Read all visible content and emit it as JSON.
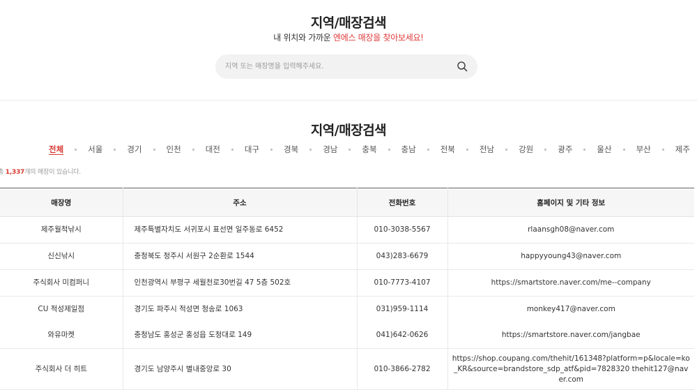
{
  "header": {
    "title": "지역/매장검색",
    "subtitle_prefix": "내 위치와 가까운 ",
    "subtitle_accent": "엔에스 매장을 찾아보세요!",
    "search_placeholder": "지역 또는 매장명을 입력해주세요."
  },
  "section": {
    "title": "지역/매장검색",
    "regions": [
      "전체",
      "서울",
      "경기",
      "인천",
      "대전",
      "대구",
      "경북",
      "경남",
      "충북",
      "충남",
      "전북",
      "전남",
      "강원",
      "광주",
      "울산",
      "부산",
      "제주"
    ],
    "active_region": "전체",
    "count_prefix": "총 ",
    "count_value": "1,337",
    "count_suffix": "개의 매장이 있습니다."
  },
  "table": {
    "headers": [
      "매장명",
      "주소",
      "전화번호",
      "홈페이지 및 기타 정보"
    ],
    "rows": [
      {
        "name": "제주월척낚시",
        "address": "제주특별자치도 서귀포시 표선면 일주동로 6452",
        "phone": "010-3038-5567",
        "info": "rlaansgh08@naver.com"
      },
      {
        "name": "신신낚시",
        "address": "충청북도 청주시 서원구 2순환로 1544",
        "phone": "043)283-6679",
        "info": "happyyoung43@naver.com"
      },
      {
        "name": "주식회사 미컴퍼니",
        "address": "인천광역시 부평구 세월천로30번길 47 5층 502호",
        "phone": "010-7773-4107",
        "info": "https://smartstore.naver.com/me--company"
      },
      {
        "name": "CU 적성제일점",
        "address": "경기도 파주시 적성면 청송로 1063",
        "phone": "031)959-1114",
        "info": "monkey417@naver.com"
      },
      {
        "name": "와유마켓",
        "address": "충청남도 홍성군 홍성읍 도청대로 149",
        "phone": "041)642-0626",
        "info": "https://smartstore.naver.com/jangbae"
      },
      {
        "name": "주식회사 더 히트",
        "address": "경기도 남양주시 별내중앙로 30",
        "phone": "010-3866-2782",
        "info": "https://shop.coupang.com/thehit/161348?platform=p&locale=ko_KR&source=brandstore_sdp_atf&pid=7828320 thehit127@naver.com"
      }
    ]
  },
  "colors": {
    "accent": "#d8372f",
    "search_bg": "#f2f2f2",
    "header_bg": "#f6f6f6"
  },
  "icons": {
    "search": "search-icon"
  }
}
